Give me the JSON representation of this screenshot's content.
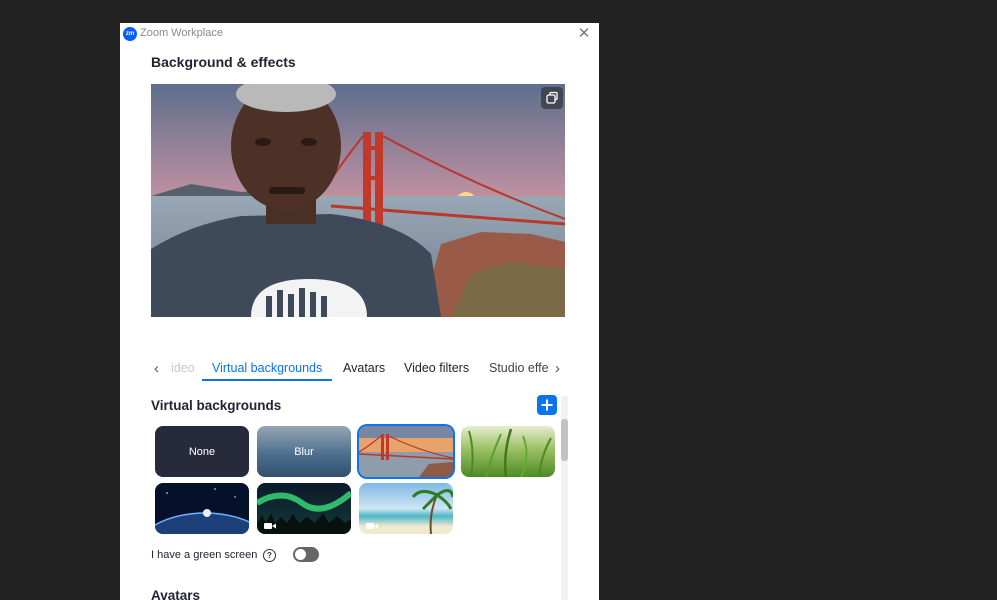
{
  "window": {
    "logo_text": "zm",
    "title": "Zoom Workplace"
  },
  "page": {
    "title": "Background & effects"
  },
  "tabs": [
    {
      "label": "ideo",
      "state": "faded"
    },
    {
      "label": "Virtual backgrounds",
      "state": "active"
    },
    {
      "label": "Avatars",
      "state": "normal"
    },
    {
      "label": "Video filters",
      "state": "normal"
    },
    {
      "label": "Studio effe",
      "state": "faded"
    }
  ],
  "virtual_backgrounds": {
    "title": "Virtual backgrounds",
    "items": [
      {
        "label": "None",
        "selected": false
      },
      {
        "label": "Blur",
        "selected": false
      },
      {
        "label": "",
        "selected": true
      },
      {
        "label": "",
        "selected": false
      },
      {
        "label": "",
        "selected": false
      },
      {
        "label": "",
        "selected": false
      },
      {
        "label": "",
        "selected": false
      }
    ]
  },
  "green_screen": {
    "label": "I have a green screen",
    "help": "?",
    "enabled": false
  },
  "avatars_section": {
    "title": "Avatars"
  },
  "colors": {
    "accent": "#0e72ed",
    "background": "#222222"
  },
  "icons": [
    "close-icon",
    "chevron-left-icon",
    "chevron-right-icon",
    "plus-icon",
    "help-icon",
    "pop-out-icon",
    "video-camera-icon"
  ]
}
